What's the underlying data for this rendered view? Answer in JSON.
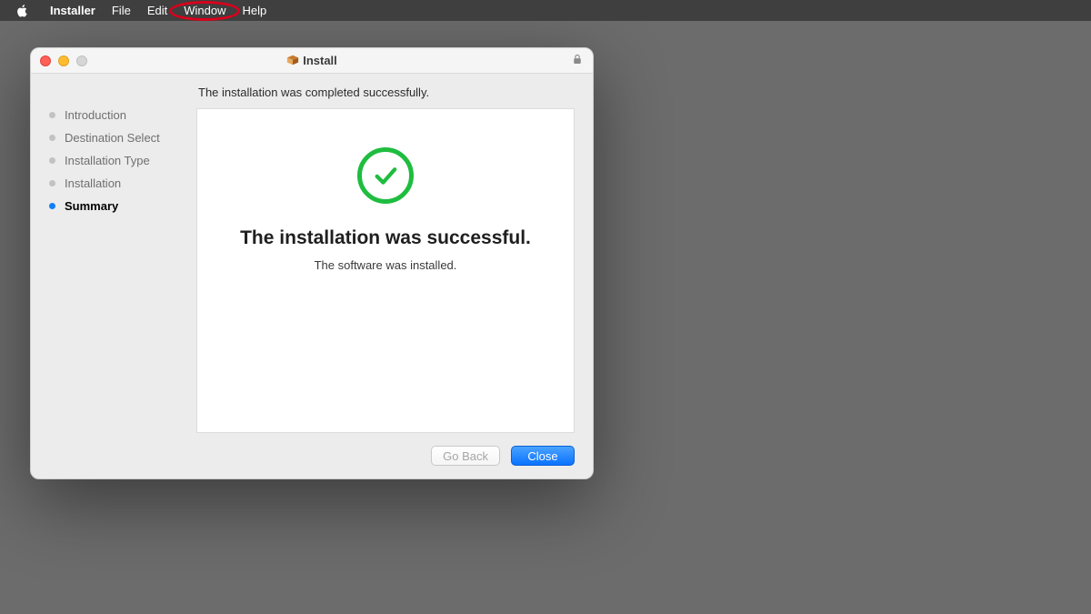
{
  "menubar": {
    "app_name": "Installer",
    "items": [
      "File",
      "Edit",
      "Window",
      "Help"
    ],
    "highlighted_index": 2
  },
  "window": {
    "title": "Install"
  },
  "headline": "The installation was completed successfully.",
  "sidebar": {
    "steps": [
      {
        "label": "Introduction",
        "active": false
      },
      {
        "label": "Destination Select",
        "active": false
      },
      {
        "label": "Installation Type",
        "active": false
      },
      {
        "label": "Installation",
        "active": false
      },
      {
        "label": "Summary",
        "active": true
      }
    ]
  },
  "panel": {
    "big": "The installation was successful.",
    "sub": "The software was installed.",
    "success_color": "#1fbd3f"
  },
  "footer": {
    "go_back": "Go Back",
    "close": "Close"
  }
}
